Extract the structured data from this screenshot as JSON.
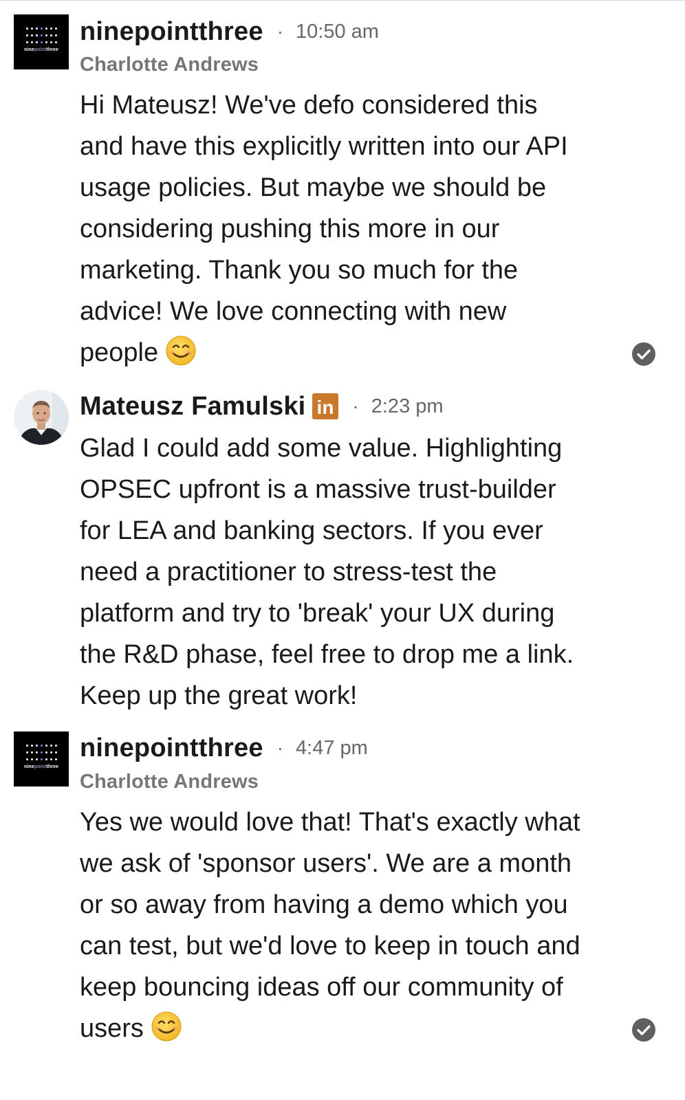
{
  "messages": [
    {
      "author": "ninepointthree",
      "separator": "·",
      "time": "10:50 am",
      "subtitle": "Charlotte Andrews",
      "avatar": {
        "type": "logo",
        "wordmark_a": "nine",
        "wordmark_b": "point",
        "wordmark_c": "three"
      },
      "lines": [
        "Hi Mateusz! We've defo considered this",
        "and have this explicitly written into our API",
        "usage policies. But maybe we should be",
        "considering pushing this more in our",
        "marketing. Thank you so much for the",
        "advice! We love connecting with new",
        "people"
      ],
      "emoji": "smiling-face-icon",
      "read_receipt": "check-circle-icon"
    },
    {
      "author": "Mateusz Famulski",
      "badge": "in",
      "separator": "·",
      "time": "2:23 pm",
      "avatar": {
        "type": "photo"
      },
      "lines": [
        "Glad I could add some value. Highlighting",
        "OPSEC upfront is a massive trust-builder",
        "for LEA and banking sectors. If you ever",
        "need a practitioner to stress-test the",
        "platform and try to 'break' your UX during",
        "the R&D phase, feel free to drop me a link.",
        "Keep up the great work!"
      ]
    },
    {
      "author": "ninepointthree",
      "separator": "·",
      "time": "4:47 pm",
      "subtitle": "Charlotte Andrews",
      "avatar": {
        "type": "logo",
        "wordmark_a": "nine",
        "wordmark_b": "point",
        "wordmark_c": "three"
      },
      "lines": [
        "Yes we would love that! That's exactly what",
        "we ask of 'sponsor users'. We are a month",
        "or so away from having a demo which you",
        "can test, but we'd love to keep in touch and",
        "keep bouncing ideas off our community of",
        "users"
      ],
      "emoji": "smiling-face-icon",
      "read_receipt": "check-circle-icon"
    }
  ],
  "colors": {
    "text": "#1a1a1a",
    "meta": "#666666",
    "subtitle": "#767676",
    "linkedin_badge": "#c8782a",
    "receipt": "#5f5f5f",
    "emoji_fill": "#f7c531"
  }
}
